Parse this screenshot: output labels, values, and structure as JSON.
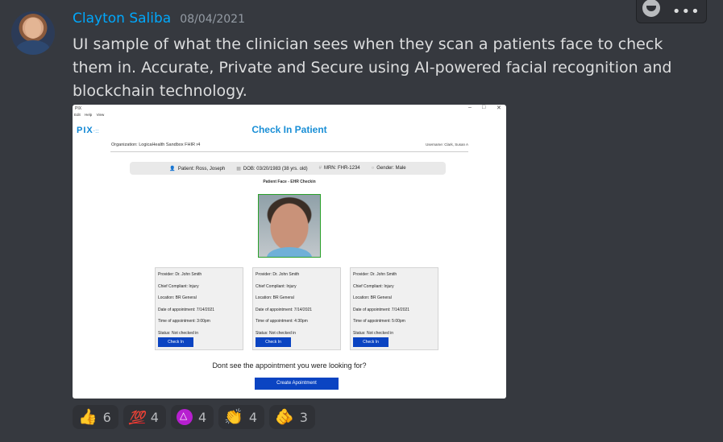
{
  "message": {
    "author": "Clayton Saliba",
    "timestamp": "08/04/2021",
    "text": "UI sample of what the clinician sees when they scan a patients face to check them in. Accurate, Private and Secure using AI-powered facial recognition and blockchain technology."
  },
  "actions": {
    "more": "•••"
  },
  "screenshot": {
    "window": {
      "app": "PIX",
      "minimize": "–",
      "maximize": "□",
      "close": "✕"
    },
    "menu": [
      "Edit",
      "Help",
      "View"
    ],
    "logo": "PIX",
    "logo_dots": "·::",
    "title": "Check In Patient",
    "organization": "Organization: LogicaHealth Sandbox FHIR r4",
    "username": "Username: Clark, Susan A",
    "patient": {
      "name": "Patient:  Ross, Joseph",
      "dob": "DOB:  03/20/1983 (38 yrs. old)",
      "mrn": "MRN:  FHR-1234",
      "gender": "Gender:  Male"
    },
    "face_caption": "Patient Face - EHR Checkin",
    "appointments": [
      {
        "provider": "Provider: Dr. John Smith",
        "complaint": "Chief Compliant: Injury",
        "location": "Location: BR General",
        "date": "Date of appointment: 7/14/2021",
        "time": "Time of appointment: 3:00pm",
        "status": "Status: Not checked in",
        "button": "Check In"
      },
      {
        "provider": "Provider: Dr. John Smith",
        "complaint": "Chief Compliant: Injury",
        "location": "Location: BR General",
        "date": "Date of appointment: 7/14/2021",
        "time": "Time of appointment: 4:30pm",
        "status": "Status: Not checked in",
        "button": "Check In"
      },
      {
        "provider": "Provider: Dr. John Smith",
        "complaint": "Chief Compliant: Injury",
        "location": "Location: BR General",
        "date": "Date of appointment: 7/14/2021",
        "time": "Time of appointment: 5:00pm",
        "status": "Status: Not checked in",
        "button": "Check In"
      }
    ],
    "missing_text": "Dont see the appointment you were looking for?",
    "create_button": "Create Apointment"
  },
  "reactions": [
    {
      "emoji": "thumbs-up",
      "glyph": "👍",
      "count": "6"
    },
    {
      "emoji": "hundred-points",
      "glyph": "💯",
      "count": "4"
    },
    {
      "emoji": "crypto-logo",
      "glyph": "",
      "count": "4"
    },
    {
      "emoji": "clapping-hands",
      "glyph": "👏",
      "count": "4"
    },
    {
      "emoji": "pointing-hand",
      "glyph": "🫵",
      "count": "3"
    }
  ],
  "colors": {
    "background": "#36393f",
    "author": "#00a8fc",
    "button": "#0b44c2",
    "title": "#1a8fd6"
  }
}
